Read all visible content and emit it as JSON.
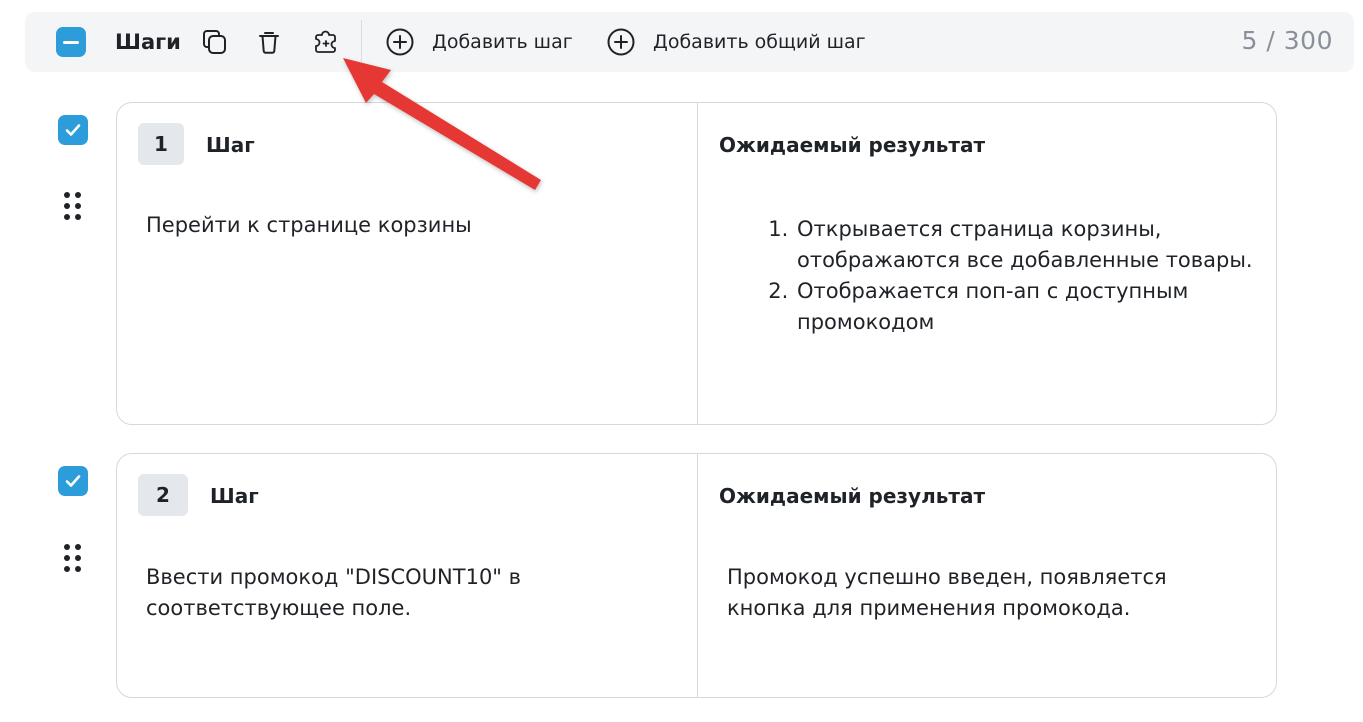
{
  "toolbar": {
    "title": "Шаги",
    "add_step_label": "Добавить шаг",
    "add_shared_step_label": "Добавить общий шаг",
    "counter": "5 / 300",
    "icons": {
      "master_checkbox": "minus-checkbox-icon",
      "copy": "copy-icon",
      "delete": "trash-icon",
      "shared_step": "puzzle-icon",
      "add": "plus-circle-icon"
    }
  },
  "steps": [
    {
      "number": "1",
      "step_title": "Шаг",
      "action": "Перейти к странице корзины",
      "result_title": "Ожидаемый результат",
      "results": [
        "Открывается страница корзины, отображаются все добавленные товары.",
        "Отображается поп-ап с доступным промокодом"
      ],
      "checked": true
    },
    {
      "number": "2",
      "step_title": "Шаг",
      "action": "Ввести промокод \"DISCOUNT10\" в соответствующее поле.",
      "result_title": "Ожидаемый результат",
      "result_text": "Промокод успешно введен, появляется кнопка для применения промокода.",
      "checked": true
    }
  ],
  "colors": {
    "accent": "#2d9cdb",
    "toolbar_bg": "#f4f5f7",
    "border": "#d5d8dd",
    "badge_bg": "#e4e8ec",
    "counter_text": "#8a9099",
    "annotation_arrow": "#e53935"
  }
}
